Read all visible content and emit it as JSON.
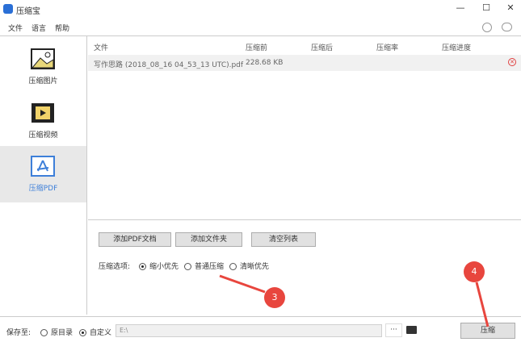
{
  "window": {
    "title": "压缩宝",
    "minimize": "—",
    "maximize": "☐",
    "close": "✕"
  },
  "menu": [
    "文件",
    "语言",
    "帮助"
  ],
  "sidebar": {
    "items": [
      {
        "label": "压缩图片"
      },
      {
        "label": "压缩视频"
      },
      {
        "label": "压缩PDF",
        "selected": true
      }
    ]
  },
  "table": {
    "headers": [
      "文件",
      "压缩前",
      "压缩后",
      "压缩率",
      "压缩进度"
    ],
    "rows": [
      {
        "file": "写作思路 (2018_08_16 04_53_13 UTC).pdf",
        "before": "228.68 KB",
        "after": "",
        "ratio": "",
        "progress": ""
      }
    ]
  },
  "buttons": {
    "add_pdf": "添加PDF文档",
    "add_folder": "添加文件夹",
    "clear": "清空列表"
  },
  "options": {
    "label": "压缩选项:",
    "choices": [
      "缩小优先",
      "普通压缩",
      "清晰优先"
    ],
    "selected": 0
  },
  "save": {
    "label": "保存至:",
    "choices": [
      "原目录",
      "自定义"
    ],
    "selected": 1,
    "path": "E:\\",
    "browse": "···",
    "compress": "压缩"
  },
  "annotations": [
    "3",
    "4"
  ],
  "colors": {
    "accent": "#3d7fd9",
    "annotation": "#e8463e"
  }
}
